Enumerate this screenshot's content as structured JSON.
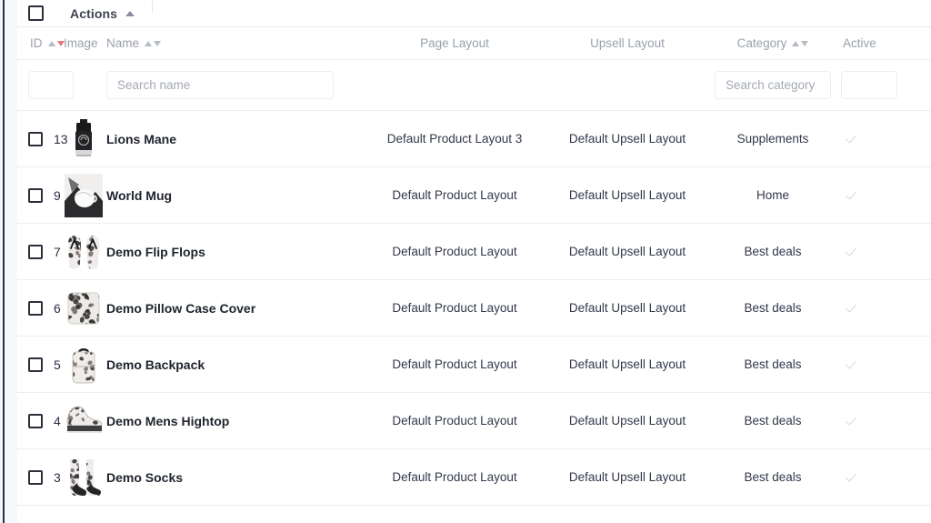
{
  "toolbar": {
    "actions_label": "Actions",
    "actions_caret": "caret-up-icon",
    "select_all_checkbox": ""
  },
  "table": {
    "columns": [
      {
        "key": "id",
        "label": "ID",
        "sortable": true,
        "sort_state": "desc"
      },
      {
        "key": "image",
        "label": "Image",
        "sortable": false,
        "sort_state": "none"
      },
      {
        "key": "name",
        "label": "Name",
        "sortable": true,
        "sort_state": "none"
      },
      {
        "key": "page",
        "label": "Page Layout",
        "sortable": false,
        "sort_state": "none"
      },
      {
        "key": "upsell",
        "label": "Upsell Layout",
        "sortable": false,
        "sort_state": "none"
      },
      {
        "key": "cat",
        "label": "Category",
        "sortable": true,
        "sort_state": "none"
      },
      {
        "key": "active",
        "label": "Active",
        "sortable": false,
        "sort_state": "none"
      }
    ],
    "filters": {
      "id_value": "",
      "id_placeholder": "",
      "name_value": "",
      "name_placeholder": "Search name",
      "category_value": "",
      "category_placeholder": "Search category",
      "active_value": "",
      "active_placeholder": ""
    },
    "rows": [
      {
        "id": "13",
        "name": "Lions Mane",
        "page_layout": "Default Product Layout 3",
        "upsell_layout": "Default Upsell Layout",
        "category": "Supplements",
        "active": true,
        "thumb": "supplement-bottle-thumbnail"
      },
      {
        "id": "9",
        "name": "World Mug",
        "page_layout": "Default Product Layout",
        "upsell_layout": "Default Upsell Layout",
        "category": "Home",
        "active": true,
        "thumb": "mug-thumbnail"
      },
      {
        "id": "7",
        "name": "Demo Flip Flops",
        "page_layout": "Default Product Layout",
        "upsell_layout": "Default Upsell Layout",
        "category": "Best deals",
        "active": true,
        "thumb": "flip-flops-thumbnail"
      },
      {
        "id": "6",
        "name": "Demo Pillow Case Cover",
        "page_layout": "Default Product Layout",
        "upsell_layout": "Default Upsell Layout",
        "category": "Best deals",
        "active": true,
        "thumb": "pillow-thumbnail"
      },
      {
        "id": "5",
        "name": "Demo Backpack",
        "page_layout": "Default Product Layout",
        "upsell_layout": "Default Upsell Layout",
        "category": "Best deals",
        "active": true,
        "thumb": "backpack-thumbnail"
      },
      {
        "id": "4",
        "name": "Demo Mens Hightop",
        "page_layout": "Default Product Layout",
        "upsell_layout": "Default Upsell Layout",
        "category": "Best deals",
        "active": true,
        "thumb": "hightop-shoe-thumbnail"
      },
      {
        "id": "3",
        "name": "Demo Socks",
        "page_layout": "Default Product Layout",
        "upsell_layout": "Default Upsell Layout",
        "category": "Best deals",
        "active": true,
        "thumb": "socks-thumbnail"
      }
    ]
  },
  "colors": {
    "rail": "#29304e",
    "sort_active": "#e8737d",
    "header_text": "#9aa0ab",
    "body_text": "#2f3440",
    "check": "#d6d9df",
    "border": "#eceef1"
  }
}
